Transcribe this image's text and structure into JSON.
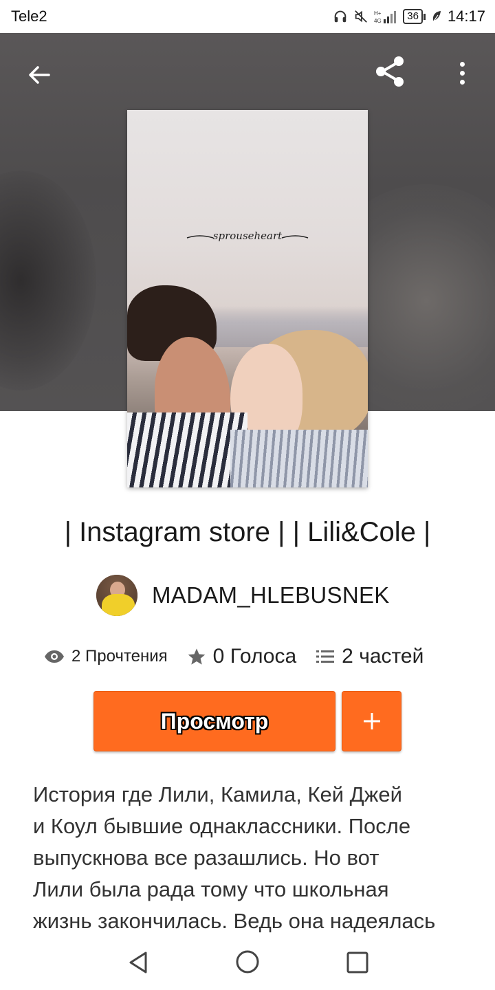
{
  "status_bar": {
    "carrier": "Tele2",
    "network": "H+ 4G",
    "battery": "36",
    "time": "14:17"
  },
  "toolbar": {
    "back_icon": "arrow-left-icon",
    "share_icon": "share-icon",
    "more_icon": "more-vertical-icon"
  },
  "story": {
    "title": "| Instagram store | | Lili&Cole |",
    "cover_script": "sprouseheart",
    "author": {
      "name": "MADAM_HLEBUSNEK"
    },
    "stats": {
      "reads": "2 Прочтения",
      "votes": "0 Голоса",
      "parts": "2 частей"
    },
    "actions": {
      "read_label": "Просмотр",
      "add_label": "+"
    },
    "description_lines": [
      "История где Лили, Камила, Кей Джей",
      "и Коул бывшие однаклассники. После",
      "выпускнова все разашлись. Но вот",
      "Лили была рада тому что школьная",
      "жизнь закончилась. Ведь она надеялась"
    ]
  },
  "colors": {
    "accent": "#ff6b1f",
    "hero_bg": "#545253",
    "text": "#1a1a1a"
  }
}
